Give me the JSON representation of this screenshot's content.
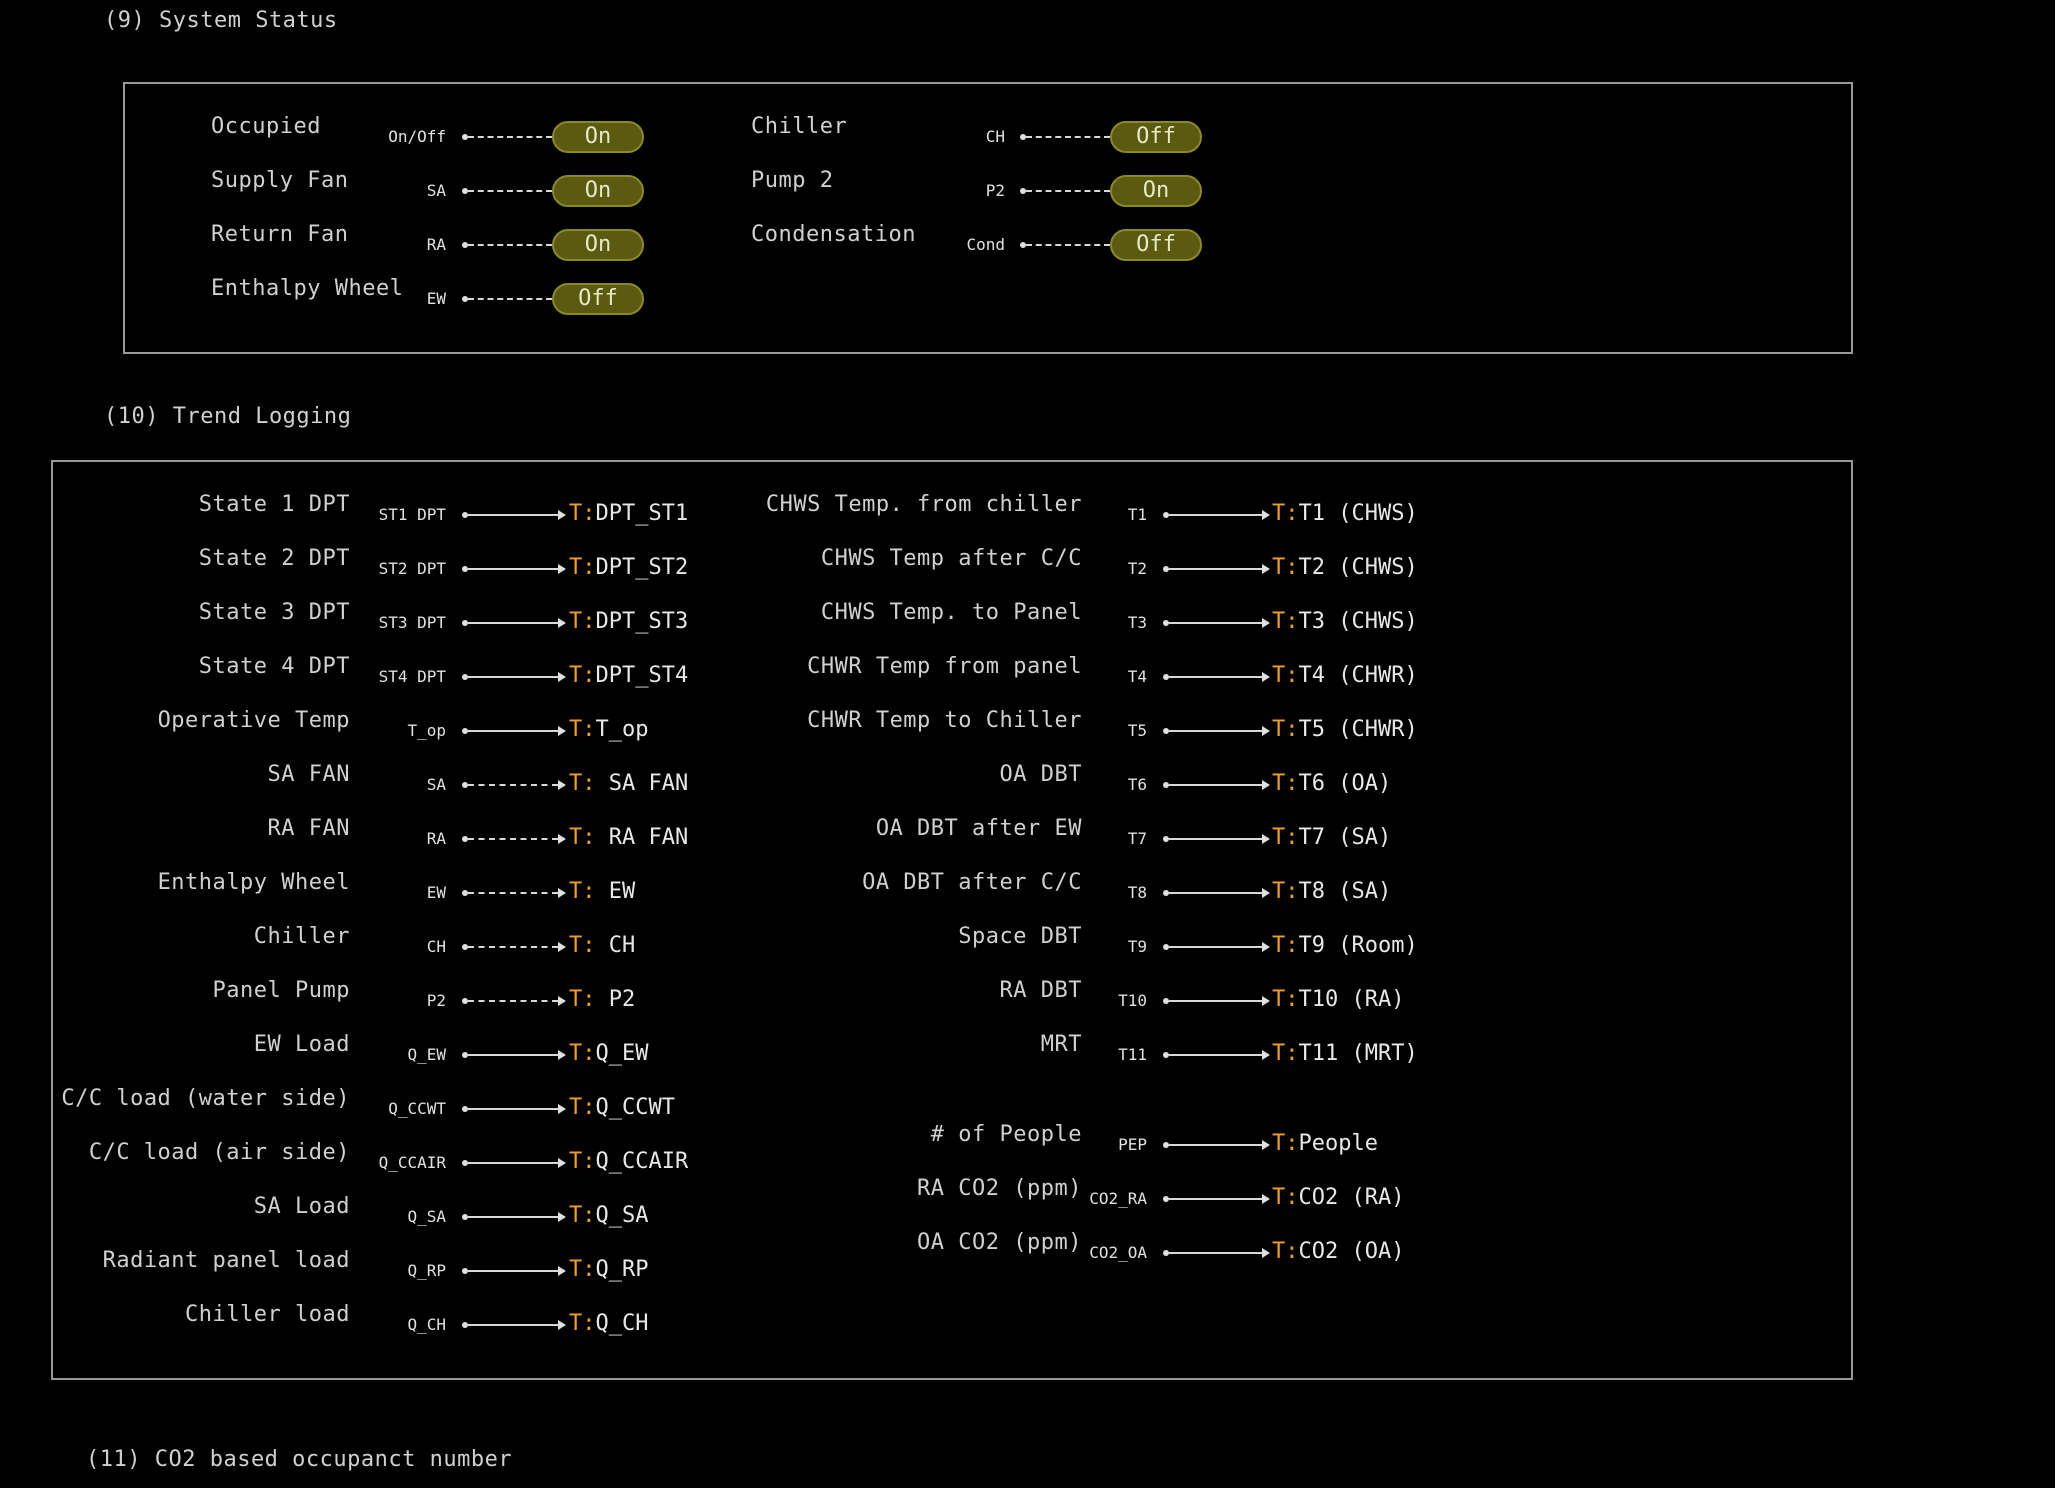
{
  "sections": {
    "system_status": "(9) System Status",
    "trend_logging": "(10) Trend Logging",
    "co2_occupancy": "(11) CO2 based occupanct number"
  },
  "status_left": [
    {
      "label": "Occupied",
      "tag": "On/Off",
      "value": "On"
    },
    {
      "label": "Supply Fan",
      "tag": "SA",
      "value": "On"
    },
    {
      "label": "Return Fan",
      "tag": "RA",
      "value": "On"
    },
    {
      "label": "Enthalpy Wheel",
      "tag": "EW",
      "value": "Off"
    }
  ],
  "status_right": [
    {
      "label": "Chiller",
      "tag": "CH",
      "value": "Off"
    },
    {
      "label": "Pump 2",
      "tag": "P2",
      "value": "On"
    },
    {
      "label": "Condensation",
      "tag": "Cond",
      "value": "Off"
    }
  ],
  "trend_prefix": "T:",
  "trend_left": [
    {
      "label": "State 1 DPT",
      "tag": "ST1 DPT",
      "target": "DPT_ST1"
    },
    {
      "label": "State 2 DPT",
      "tag": "ST2 DPT",
      "target": "DPT_ST2"
    },
    {
      "label": "State 3 DPT",
      "tag": "ST3 DPT",
      "target": "DPT_ST3"
    },
    {
      "label": "State 4 DPT",
      "tag": "ST4 DPT",
      "target": "DPT_ST4"
    },
    {
      "label": "Operative Temp",
      "tag": "T_op",
      "target": "T_op"
    },
    {
      "label": "SA FAN",
      "tag": "SA",
      "target": " SA FAN"
    },
    {
      "label": "RA FAN",
      "tag": "RA",
      "target": " RA FAN"
    },
    {
      "label": "Enthalpy Wheel",
      "tag": "EW",
      "target": " EW"
    },
    {
      "label": "Chiller",
      "tag": "CH",
      "target": " CH"
    },
    {
      "label": "Panel Pump",
      "tag": "P2",
      "target": " P2"
    },
    {
      "label": "EW Load",
      "tag": "Q_EW",
      "target": "Q_EW"
    },
    {
      "label": "C/C load (water side)",
      "tag": "Q_CCWT",
      "target": "Q_CCWT"
    },
    {
      "label": "C/C load (air side)",
      "tag": "Q_CCAIR",
      "target": "Q_CCAIR"
    },
    {
      "label": "SA Load",
      "tag": "Q_SA",
      "target": "Q_SA"
    },
    {
      "label": "Radiant panel load",
      "tag": "Q_RP",
      "target": "Q_RP"
    },
    {
      "label": "Chiller load",
      "tag": "Q_CH",
      "target": "Q_CH"
    }
  ],
  "trend_right": [
    {
      "label": "CHWS Temp. from chiller",
      "tag": "T1",
      "target": "T1 (CHWS)"
    },
    {
      "label": "CHWS Temp after C/C",
      "tag": "T2",
      "target": "T2 (CHWS)"
    },
    {
      "label": "CHWS Temp. to Panel",
      "tag": "T3",
      "target": "T3 (CHWS)"
    },
    {
      "label": "CHWR Temp from panel",
      "tag": "T4",
      "target": "T4 (CHWR)"
    },
    {
      "label": "CHWR Temp to Chiller",
      "tag": "T5",
      "target": "T5 (CHWR)"
    },
    {
      "label": "OA DBT",
      "tag": "T6",
      "target": "T6 (OA)"
    },
    {
      "label": "OA DBT after EW",
      "tag": "T7",
      "target": "T7 (SA)"
    },
    {
      "label": "OA DBT after C/C",
      "tag": "T8",
      "target": "T8 (SA)"
    },
    {
      "label": "Space DBT",
      "tag": "T9",
      "target": "T9 (Room)"
    },
    {
      "label": "RA DBT",
      "tag": "T10",
      "target": "T10 (RA)"
    },
    {
      "label": "MRT",
      "tag": "T11",
      "target": "T11 (MRT)"
    },
    {
      "label": "# of People",
      "tag": "PEP",
      "target": "People"
    },
    {
      "label": "RA CO2 (ppm)",
      "tag": "CO2_RA",
      "target": "CO2 (RA)"
    },
    {
      "label": "OA CO2 (ppm)",
      "tag": "CO2_OA",
      "target": "CO2 (OA)"
    }
  ]
}
